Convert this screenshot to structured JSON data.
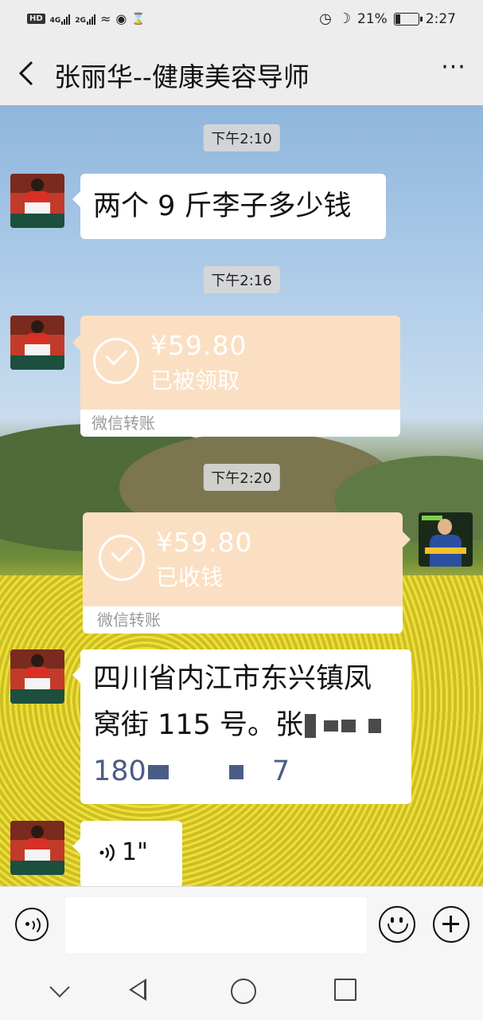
{
  "status_bar": {
    "hd": "HD",
    "net1": "4G",
    "net2": "2G",
    "battery_percent": "21%",
    "time": "2:27",
    "icons": [
      "hd-icon",
      "signal-icon",
      "wifi-icon",
      "eye-icon",
      "hourglass-icon",
      "alarm-icon",
      "moon-icon",
      "battery-icon"
    ]
  },
  "header": {
    "title": "张丽华--健康美容导师",
    "back_icon": "back-arrow-icon",
    "more_icon": "more-icon",
    "more_label": "···"
  },
  "messages": [
    {
      "type": "time",
      "text": "下午2:10"
    },
    {
      "type": "text",
      "side": "left",
      "text": "两个 9 斤李子多少钱"
    },
    {
      "type": "time",
      "text": "下午2:16"
    },
    {
      "type": "transfer",
      "side": "left",
      "amount": "¥59.80",
      "status": "已被领取",
      "footer": "微信转账"
    },
    {
      "type": "time",
      "text": "下午2:20"
    },
    {
      "type": "transfer",
      "side": "right",
      "amount": "¥59.80",
      "status": "已收钱",
      "footer": "微信转账"
    },
    {
      "type": "text",
      "side": "left",
      "line1": "四川省内江市东兴镇凤",
      "line2_prefix": "窝街 115 号。张",
      "phone_prefix": "180",
      "phone_suffix": "7"
    },
    {
      "type": "voice",
      "side": "left",
      "duration": "1\""
    }
  ],
  "input_bar": {
    "voice_icon": "voice-input-icon",
    "emoji_icon": "emoji-icon",
    "plus_icon": "plus-icon",
    "value": ""
  },
  "nav_bar": {
    "icons": [
      "nav-hide-icon",
      "nav-back-icon",
      "nav-home-icon",
      "nav-recent-icon"
    ]
  },
  "colors": {
    "transfer_bg": "#fbdfc3",
    "background": "#ededed",
    "link_blue": "#4a5d86"
  }
}
